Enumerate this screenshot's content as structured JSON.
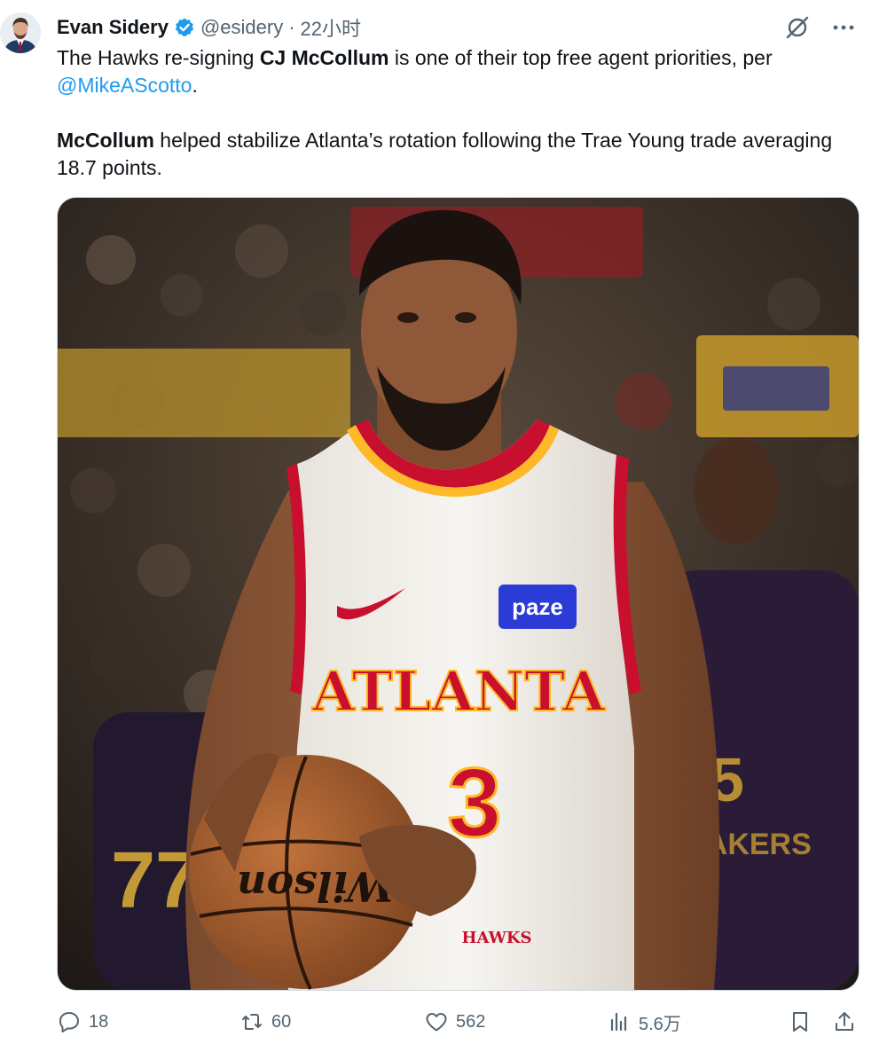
{
  "author": {
    "name": "Evan Sidery",
    "handle": "@esidery",
    "separator": "·",
    "time": "22小时"
  },
  "tweet": {
    "p1_before": "The Hawks re-signing ",
    "p1_bold": "CJ McCollum",
    "p1_after": " is one of their top free agent priorities, per",
    "p1_mention": "@MikeAScotto",
    "p1_end": ".",
    "p2_bold": "McCollum",
    "p2_rest": " helped stabilize Atlanta’s rotation following the Trae Young trade averaging 18.7 points."
  },
  "media": {
    "jersey_text": "ATLANTA",
    "jersey_number": "3",
    "sponsor_patch": "paze",
    "ball_brand": "Wilson",
    "shorts_text": "HAWKS",
    "bg_jersey_number": "77",
    "bg_player2_number": "5",
    "bg_jersey_text": "LAKERS"
  },
  "actions": {
    "replies": "18",
    "reposts": "60",
    "likes": "562",
    "views": "5.6万"
  },
  "colors": {
    "accent": "#1d9bf0",
    "muted": "#536471",
    "hawks_red": "#c8102e",
    "hawks_gold": "#fdb927",
    "lakers_purple": "#552583"
  },
  "icons": [
    "verified-badge-icon",
    "grok-icon",
    "more-icon",
    "reply-icon",
    "repost-icon",
    "like-icon",
    "views-icon",
    "bookmark-icon",
    "share-icon"
  ]
}
